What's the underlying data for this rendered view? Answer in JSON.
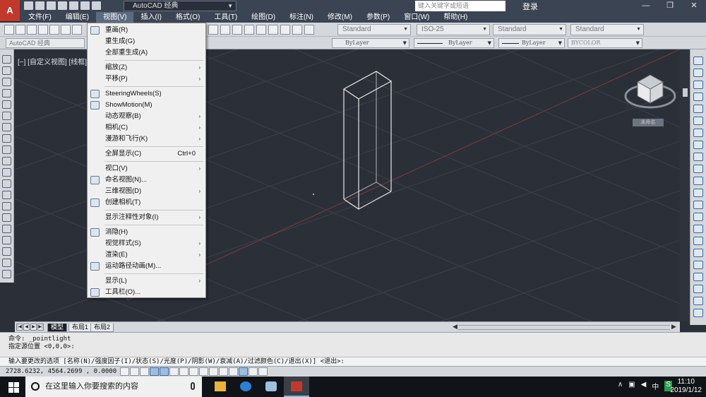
{
  "titlebar": {
    "app_logo": "A",
    "workspace": "AutoCAD 经典",
    "search_placeholder": "键入关键字或短语",
    "login": "登录",
    "minimize": "—",
    "restore": "❐",
    "close": "✕"
  },
  "menubar": {
    "items": [
      "文件(F)",
      "编辑(E)",
      "视图(V)",
      "插入(I)",
      "格式(O)",
      "工具(T)",
      "绘图(D)",
      "标注(N)",
      "修改(M)",
      "参数(P)",
      "窗口(W)",
      "帮助(H)"
    ],
    "active_index": 2
  },
  "styles": {
    "text_style": "Standard",
    "dim_style": "ISO-25",
    "table_style": "Standard",
    "mleader_style": "Standard"
  },
  "properties": {
    "workspace_combo": "AutoCAD 经典",
    "color": "ByLayer",
    "linetype": "ByLayer",
    "lineweight": "ByLayer",
    "plotstyle": "BYCOLOR"
  },
  "viewport": {
    "label": "[−] [自定义视图] [线框]",
    "viewcube_label": "未命名"
  },
  "view_menu": {
    "items": [
      {
        "label": "重画(R)",
        "icon": "pencil-icon"
      },
      {
        "label": "重生成(G)"
      },
      {
        "label": "全部重生成(A)"
      },
      {
        "label": "缩放(Z)",
        "submenu": true
      },
      {
        "label": "平移(P)",
        "submenu": true
      },
      {
        "label": "SteeringWheels(S)",
        "icon": "steering-wheel-icon"
      },
      {
        "label": "ShowMotion(M)",
        "icon": "showmotion-icon"
      },
      {
        "label": "动态观察(B)",
        "submenu": true
      },
      {
        "label": "相机(C)",
        "submenu": true
      },
      {
        "label": "漫游和飞行(K)",
        "submenu": true
      },
      {
        "label": "全屏显示(C)",
        "shortcut": "Ctrl+0"
      },
      {
        "label": "视口(V)",
        "submenu": true
      },
      {
        "label": "命名视图(N)...",
        "icon": "named-view-icon"
      },
      {
        "label": "三维视图(D)",
        "submenu": true
      },
      {
        "label": "创建相机(T)",
        "icon": "camera-icon"
      },
      {
        "label": "显示注释性对象(I)",
        "submenu": true
      },
      {
        "label": "消隐(H)",
        "icon": "hide-icon"
      },
      {
        "label": "视觉样式(S)",
        "submenu": true
      },
      {
        "label": "渲染(E)",
        "submenu": true
      },
      {
        "label": "运动路径动画(M)...",
        "icon": "motion-path-icon"
      },
      {
        "label": "显示(L)",
        "submenu": true
      },
      {
        "label": "工具栏(O)...",
        "icon": "toolbar-icon"
      }
    ]
  },
  "layout_tabs": {
    "model": "模型",
    "layout1": "布局1",
    "layout2": "布局2"
  },
  "command": {
    "history_line1": "命令: _pointlight",
    "history_line2": "指定源位置 <0,0,0>:",
    "prompt": "输入要更改的选项 [名称(N)/强度因子(I)/状态(S)/光度(P)/阴影(W)/衰减(A)/过滤颜色(C)/退出(X)] <退出>:"
  },
  "status": {
    "coordinates": "2728.6232, 4564.2699 , 0.0000"
  },
  "taskbar": {
    "search_placeholder": "在这里输入你要搜索的内容",
    "time": "11:10",
    "date": "2019/1/12",
    "tray_label": "S"
  },
  "colors": {
    "viewport_bg": "#2b2f38",
    "menu_active": "#5d6b82",
    "title_bg": "#3b4453"
  }
}
